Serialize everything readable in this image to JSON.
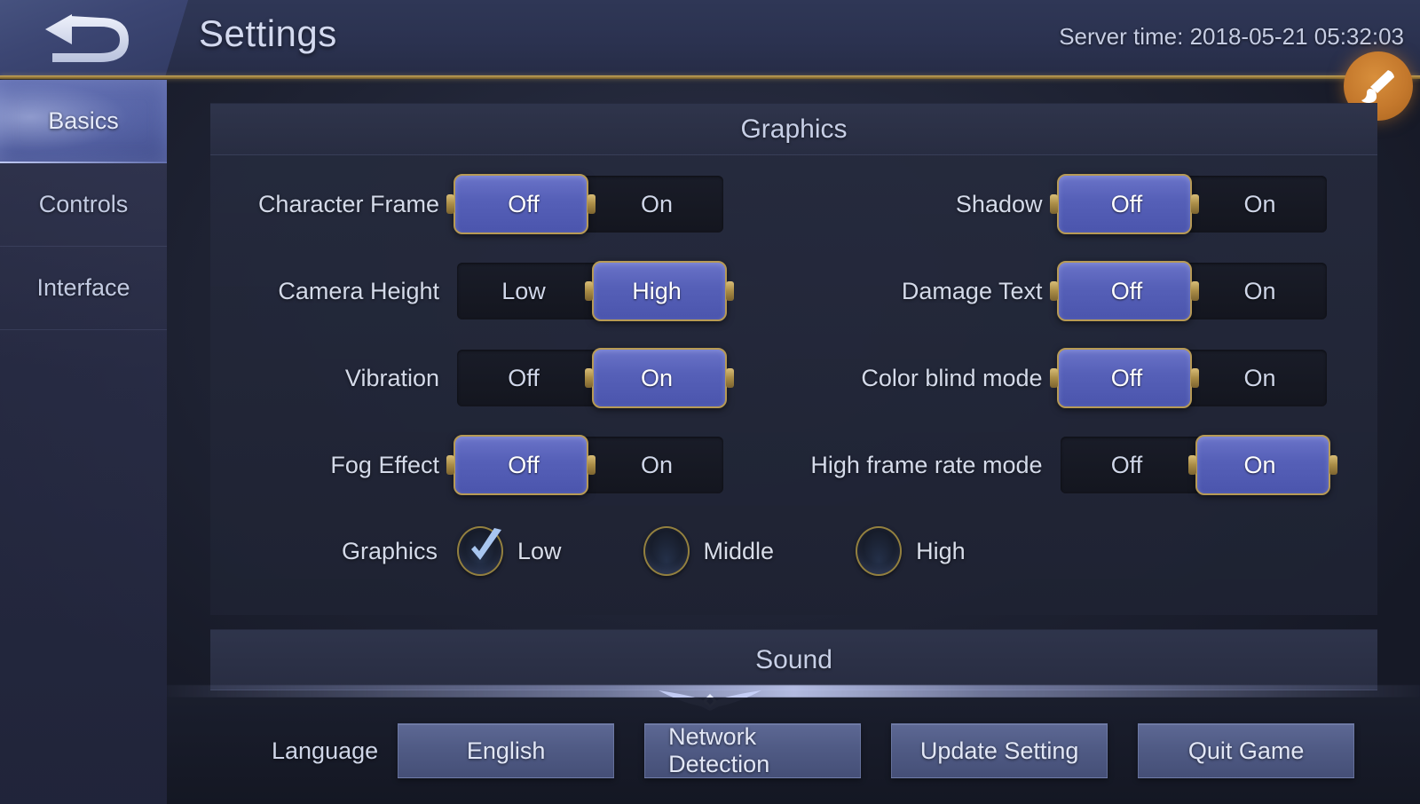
{
  "header": {
    "back_icon": "back-arrow-icon",
    "title": "Settings",
    "server_time": "Server time: 2018-05-21 05:32:03",
    "brush_icon": "paint-brush-icon"
  },
  "sidebar": {
    "items": [
      {
        "label": "Basics",
        "active": true
      },
      {
        "label": "Controls",
        "active": false
      },
      {
        "label": "Interface",
        "active": false
      }
    ]
  },
  "sections": [
    {
      "title": "Graphics",
      "toggles_left": [
        {
          "label": "Character Frame",
          "options": [
            "Off",
            "On"
          ],
          "selected": "Off",
          "selected_index": 0
        },
        {
          "label": "Camera Height",
          "options": [
            "Low",
            "High"
          ],
          "selected": "High",
          "selected_index": 1
        },
        {
          "label": "Vibration",
          "options": [
            "Off",
            "On"
          ],
          "selected": "On",
          "selected_index": 1
        },
        {
          "label": "Fog Effect",
          "options": [
            "Off",
            "On"
          ],
          "selected": "Off",
          "selected_index": 0
        }
      ],
      "toggles_right": [
        {
          "label": "Shadow",
          "options": [
            "Off",
            "On"
          ],
          "selected": "Off",
          "selected_index": 0
        },
        {
          "label": "Damage Text",
          "options": [
            "Off",
            "On"
          ],
          "selected": "Off",
          "selected_index": 0
        },
        {
          "label": "Color blind mode",
          "options": [
            "Off",
            "On"
          ],
          "selected": "Off",
          "selected_index": 0
        },
        {
          "label": "High frame rate mode",
          "options": [
            "Off",
            "On"
          ],
          "selected": "On",
          "selected_index": 1
        }
      ],
      "quality": {
        "label": "Graphics",
        "options": [
          {
            "label": "Low",
            "checked": true
          },
          {
            "label": "Middle",
            "checked": false
          },
          {
            "label": "High",
            "checked": false
          }
        ]
      }
    },
    {
      "title": "Sound"
    }
  ],
  "bottom": {
    "language_label": "Language",
    "language_value": "English",
    "network_detection": "Network Detection",
    "update_setting": "Update Setting",
    "quit_game": "Quit Game"
  },
  "colors": {
    "knob_blue": "#5660b8",
    "gold": "#b79a55",
    "brush_orange": "#c4782c",
    "accent_text": "#d4dae9"
  }
}
